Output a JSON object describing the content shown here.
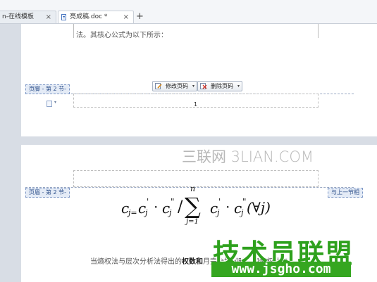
{
  "tabs": [
    {
      "label": "n-在线模板",
      "close": "×"
    },
    {
      "label": "亮成稿.doc *",
      "close": "×"
    }
  ],
  "new_tab_label": "+",
  "page1": {
    "body_text": "法。其核心公式为以下所示：",
    "footer_tag": "页脚 - 第 2 节-",
    "edit_page_number_label": "修改页码",
    "delete_page_number_label": "删除页码",
    "caret": "▾",
    "page_number": "1"
  },
  "page2": {
    "header_tag": "页眉 - 第 2 节-",
    "link_tag": "与上一节相",
    "formula": {
      "lhs": "c",
      "lhs_sub": "j=",
      "t1": "c",
      "t1_sub": "j",
      "t1_sup": "'",
      "dot1": "·",
      "t2": "c",
      "t2_sub": "j",
      "t2_sup": "\"",
      "slash": "/",
      "sum": "∑",
      "sum_top": "n",
      "sum_bottom": "j=1",
      "t3": "c",
      "t3_sub": "j",
      "t3_sup": "'",
      "dot2": "·",
      "t4": "c",
      "t4_sub": "j",
      "t4_sup": "\"",
      "tail": "(∀j)"
    },
    "bottom_text_a": "当熵权法与层次分析法得出的",
    "bottom_text_b": "权数和",
    "bottom_text_c": "月完全相同时，用熵权法的"
  },
  "watermarks": {
    "top_right": "三联网 3LIAN.COM",
    "logo": "技术员联盟",
    "url": "www.jsgho.com"
  }
}
